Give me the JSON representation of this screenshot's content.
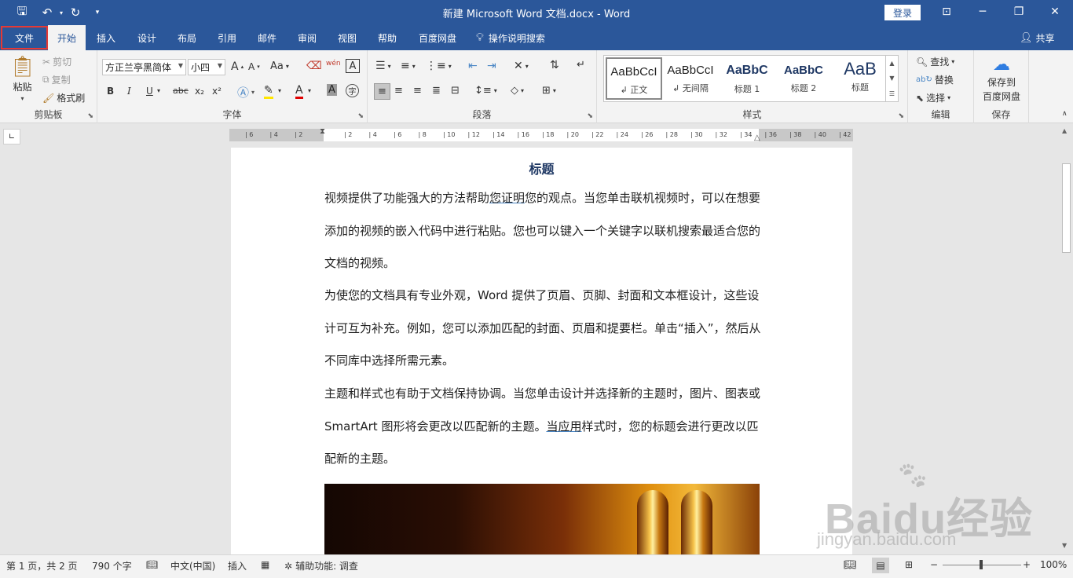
{
  "window": {
    "title": "新建 Microsoft Word 文档.docx  -  Word",
    "login_label": "登录"
  },
  "tabs": [
    {
      "label": "文件"
    },
    {
      "label": "开始"
    },
    {
      "label": "插入"
    },
    {
      "label": "设计"
    },
    {
      "label": "布局"
    },
    {
      "label": "引用"
    },
    {
      "label": "邮件"
    },
    {
      "label": "审阅"
    },
    {
      "label": "视图"
    },
    {
      "label": "帮助"
    },
    {
      "label": "百度网盘"
    }
  ],
  "tell_me": "操作说明搜索",
  "share": "共享",
  "clipboard": {
    "paste": "粘贴",
    "cut": "剪切",
    "copy": "复制",
    "format_painter": "格式刷",
    "label": "剪贴板"
  },
  "font": {
    "font_name": "方正兰亭黑简体",
    "font_size": "小四",
    "label": "字体",
    "bold": "B",
    "italic": "I",
    "underline": "U",
    "strike": "abc",
    "sub": "x₂",
    "sup": "x²",
    "grow": "A",
    "shrink": "A",
    "case": "Aa",
    "phonetic": "wén",
    "border_char": "A",
    "shade": "A",
    "enclose": "字"
  },
  "paragraph": {
    "label": "段落"
  },
  "styles": {
    "label": "样式",
    "items": [
      {
        "sample": "AaBbCcI",
        "name": "↲ 正文"
      },
      {
        "sample": "AaBbCcI",
        "name": "↲ 无间隔"
      },
      {
        "sample": "AaBbC",
        "name": "标题 1"
      },
      {
        "sample": "AaBbC",
        "name": "标题 2"
      },
      {
        "sample": "AaB",
        "name": "标题"
      }
    ]
  },
  "editing": {
    "find": "查找",
    "replace": "替换",
    "select": "选择",
    "label": "编辑"
  },
  "save_group": {
    "button_line1": "保存到",
    "button_line2": "百度网盘",
    "label": "保存"
  },
  "ruler_ticks": [
    "6",
    "4",
    "2",
    "",
    "2",
    "4",
    "6",
    "8",
    "10",
    "12",
    "14",
    "16",
    "18",
    "20",
    "22",
    "24",
    "26",
    "28",
    "30",
    "32",
    "34",
    "36",
    "38",
    "40",
    "42"
  ],
  "document": {
    "title": "标题",
    "p1_a": "视频提供了功能强大的方法帮助",
    "p1_ul": "您证明",
    "p1_b": "您的观点。当您单击联机视频时，可以在想要添加的视频的嵌入代码中进行粘贴。您也可以键入一个关键字以联机搜索最适合您的文档的视频。",
    "p2": "为使您的文档具有专业外观，Word 提供了页眉、页脚、封面和文本框设计，这些设计可互为补充。例如，您可以添加匹配的封面、页眉和提要栏。单击“插入”，然后从不同库中选择所需元素。",
    "p3_a": "主题和样式也有助于文档保持协调。当您单击设计并选择新的主题时，图片、图表或 SmartArt 图形将会更改以匹配新的主题。",
    "p3_ul": "当应用",
    "p3_b": "样式时，您的标题会进行更改以匹配新的主题。"
  },
  "status": {
    "page": "第 1 页，共 2 页",
    "words": "790 个字",
    "language": "中文(中国)",
    "insert_mode": "插入",
    "accessibility": "辅助功能: 调查",
    "zoom": "100%"
  },
  "watermark": {
    "main": "Baidu经验",
    "sub": "jingyan.baidu.com"
  }
}
